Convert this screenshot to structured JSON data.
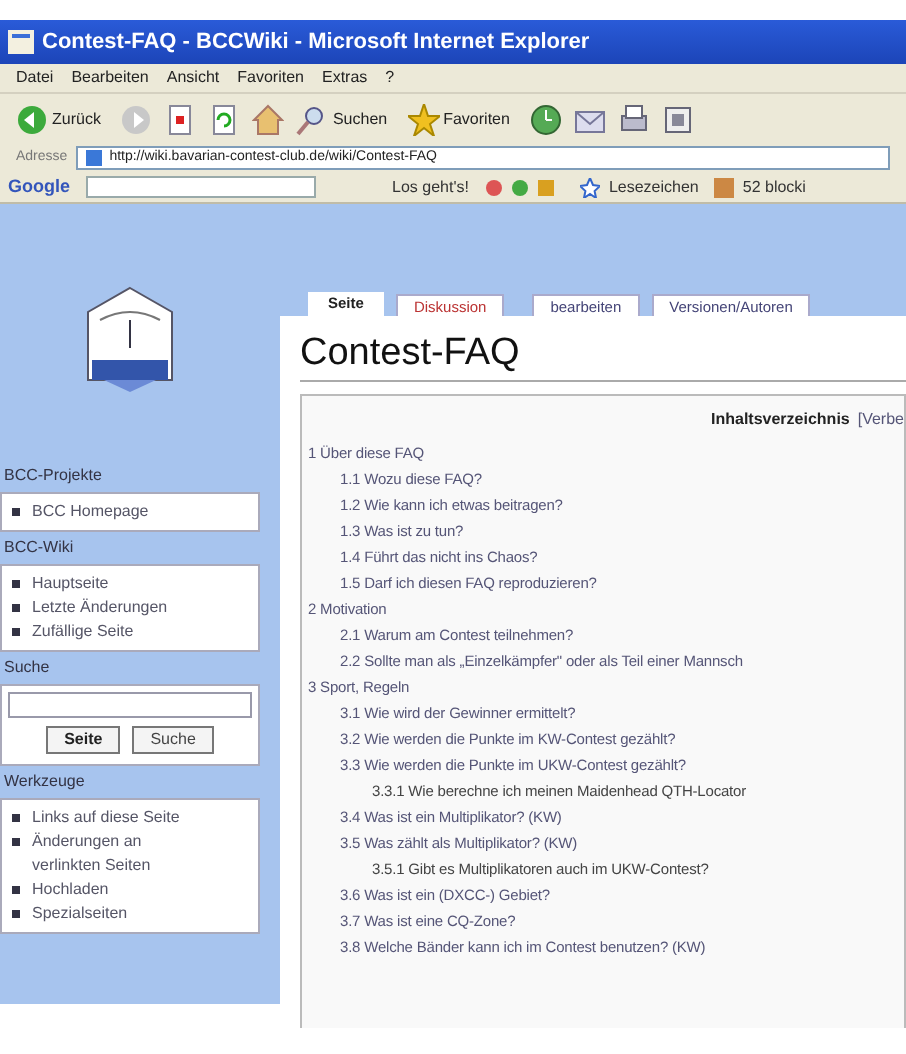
{
  "window": {
    "title": "Contest-FAQ - BCCWiki - Microsoft Internet Explorer"
  },
  "menu": [
    "Datei",
    "Bearbeiten",
    "Ansicht",
    "Favoriten",
    "Extras",
    "?"
  ],
  "toolbar": [
    {
      "kind": "back",
      "label": "Zurück"
    },
    {
      "kind": "forward"
    },
    {
      "kind": "stop"
    },
    {
      "kind": "refresh"
    },
    {
      "kind": "home"
    },
    {
      "kind": "search",
      "label": "Suchen"
    },
    {
      "kind": "favorites",
      "label": "Favoriten"
    },
    {
      "kind": "history"
    },
    {
      "kind": "mail"
    },
    {
      "kind": "print"
    },
    {
      "kind": "edit"
    }
  ],
  "address": {
    "label": "Adresse",
    "url": "http://wiki.bavarian-contest-club.de/wiki/Contest-FAQ"
  },
  "google_bar": {
    "brand": "Google",
    "go": "Los geht's!",
    "bookmarks": "Lesezeichen",
    "blocked": "52 blocki"
  },
  "sidebar": {
    "sections": [
      {
        "title": "BCC-Projekte",
        "items": [
          "BCC Homepage"
        ]
      },
      {
        "title": "BCC-Wiki",
        "items": [
          "Hauptseite",
          "Letzte Änderungen",
          "Zufällige Seite"
        ]
      },
      {
        "title": "Suche",
        "kind": "search",
        "buttons": [
          "Seite",
          "Suche"
        ]
      },
      {
        "title": "Werkzeuge",
        "items": [
          "Links auf diese Seite",
          "Änderungen an verlinkten Seiten",
          "Hochladen",
          "Spezialseiten"
        ]
      }
    ]
  },
  "tabs": [
    {
      "label": "Seite",
      "selected": true
    },
    {
      "label": "Diskussion",
      "selected": false
    },
    {
      "label": "bearbeiten",
      "selected": false
    },
    {
      "label": "Versionen/Autoren",
      "selected": false
    }
  ],
  "page_title": "Contest-FAQ",
  "toc": {
    "title": "Inhaltsverzeichnis",
    "toggle": "[Verbe",
    "items": [
      {
        "label": "1 Über diese FAQ",
        "children": [
          {
            "label": "1.1 Wozu diese FAQ?"
          },
          {
            "label": "1.2 Wie kann ich etwas beitragen?"
          },
          {
            "label": "1.3 Was ist zu tun?"
          },
          {
            "label": "1.4 Führt das nicht ins Chaos?"
          },
          {
            "label": "1.5 Darf ich diesen FAQ reproduzieren?"
          }
        ]
      },
      {
        "label": "2 Motivation",
        "children": [
          {
            "label": "2.1 Warum am Contest teilnehmen?"
          },
          {
            "label": "2.2 Sollte man als „Einzelkämpfer\" oder als Teil einer Mannsch"
          }
        ]
      },
      {
        "label": "3 Sport, Regeln",
        "children": [
          {
            "label": "3.1 Wie wird der Gewinner ermittelt?"
          },
          {
            "label": "3.2 Wie werden die Punkte im KW-Contest gezählt?"
          },
          {
            "label": "3.3 Wie werden die Punkte im UKW-Contest gezählt?",
            "children": [
              {
                "label": "3.3.1 Wie berechne ich meinen Maidenhead QTH-Locator"
              }
            ]
          },
          {
            "label": "3.4 Was ist ein Multiplikator? (KW)"
          },
          {
            "label": "3.5 Was zählt als Multiplikator? (KW)",
            "children": [
              {
                "label": "3.5.1 Gibt es Multiplikatoren auch im UKW-Contest?"
              }
            ]
          },
          {
            "label": "3.6 Was ist ein (DXCC-) Gebiet?"
          },
          {
            "label": "3.7 Was ist eine CQ-Zone?"
          },
          {
            "label": "3.8 Welche Bänder kann ich im Contest benutzen? (KW)"
          }
        ]
      }
    ]
  }
}
